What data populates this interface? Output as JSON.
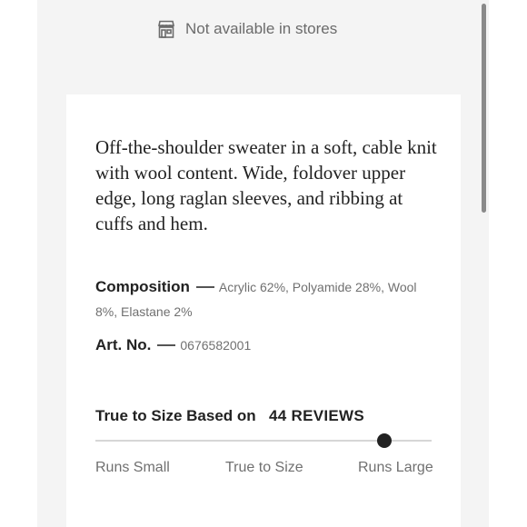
{
  "store_availability": {
    "text": "Not available in stores",
    "icon": "store-icon"
  },
  "product": {
    "description": "Off-the-shoulder sweater in a soft, cable knit with wool content. Wide, foldover upper edge, long raglan sleeves, and ribbing at cuffs and hem.",
    "composition_label": "Composition",
    "composition_value": "Acrylic 62%, Polyamide 28%, Wool 8%, Elastane 2%",
    "art_no_label": "Art. No.",
    "art_no_value": "0676582001"
  },
  "fit": {
    "title": "True to Size Based on",
    "reviews": "44 REVIEWS",
    "scale": [
      "Runs Small",
      "True to Size",
      "Runs Large"
    ],
    "level": 0.86
  },
  "colors": {
    "panel": "#f4f4f4",
    "card": "#ffffff",
    "text": "#222222",
    "muted": "#707070"
  }
}
